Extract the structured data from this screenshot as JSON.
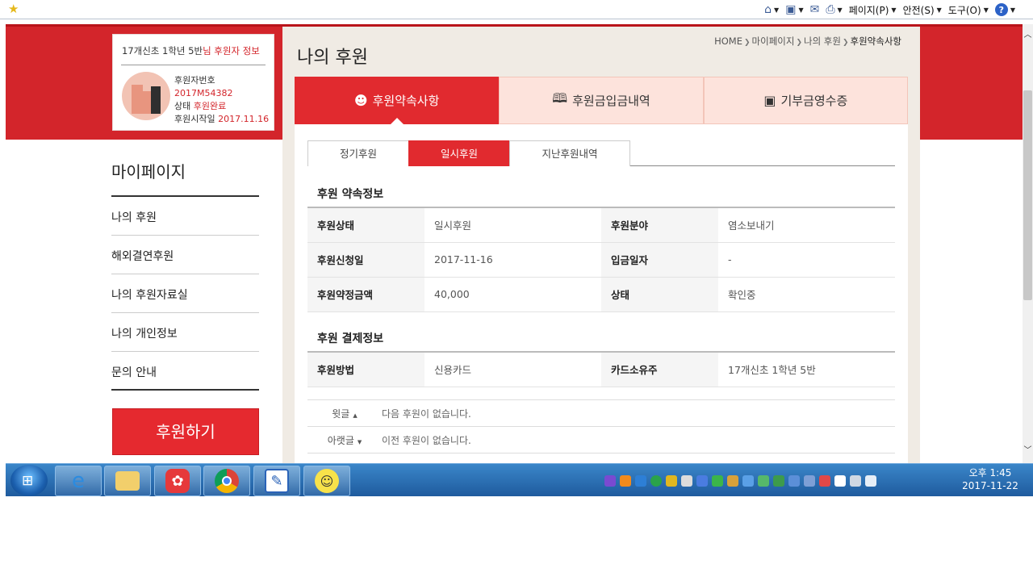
{
  "ie_toolbar": {
    "page_menu": "페이지(P)",
    "safety_menu": "안전(S)",
    "tools_menu": "도구(O)",
    "help_label": "?"
  },
  "donor": {
    "title_prefix": "17개신초 1학년 5반",
    "title_suffix": "님 후원자 정보",
    "rows": [
      {
        "label": "후원자번호",
        "value": ""
      },
      {
        "label": "",
        "value": "2017M54382"
      },
      {
        "label": "상태 ",
        "value": "후원완료"
      },
      {
        "label": "후원시작일 ",
        "value": "2017.11.16"
      }
    ]
  },
  "sidebar": {
    "title": "마이페이지",
    "items": [
      {
        "label": "나의 후원"
      },
      {
        "label": "해외결연후원"
      },
      {
        "label": "나의 후원자료실"
      },
      {
        "label": "나의 개인정보"
      },
      {
        "label": "문의 안내"
      }
    ],
    "donate_button": "후원하기"
  },
  "page": {
    "title": "나의 후원",
    "breadcrumb": [
      "HOME",
      "마이페이지",
      "나의 후원",
      "후원약속사항"
    ]
  },
  "big_tabs": [
    {
      "label": "후원약속사항",
      "icon": "smiley-icon",
      "glyph": "☻"
    },
    {
      "label": "후원금입금내역",
      "icon": "book-icon",
      "glyph": "🕮"
    },
    {
      "label": "기부금영수증",
      "icon": "receipt-icon",
      "glyph": "▣"
    }
  ],
  "sub_tabs": [
    {
      "label": "정기후원"
    },
    {
      "label": "일시후원"
    },
    {
      "label": "지난후원내역"
    }
  ],
  "promise_section": {
    "title": "후원 약속정보",
    "rows": [
      {
        "l1": "후원상태",
        "v1": "일시후원",
        "l2": "후원분야",
        "v2": "염소보내기"
      },
      {
        "l1": "후원신청일",
        "v1": "2017-11-16",
        "l2": "입금일자",
        "v2": "-"
      },
      {
        "l1": "후원약정금액",
        "v1": "40,000",
        "l2": "상태",
        "v2": "확인중"
      }
    ]
  },
  "payment_section": {
    "title": "후원 결제정보",
    "rows": [
      {
        "l1": "후원방법",
        "v1": "신용카드",
        "l2": "카드소유주",
        "v2": "17개신초 1학년 5반"
      }
    ]
  },
  "post_nav": [
    {
      "label": "윗글",
      "arrow": "▲",
      "text": "다음 후원이 없습니다."
    },
    {
      "label": "아랫글",
      "arrow": "▼",
      "text": "이전 후원이 없습니다."
    }
  ],
  "taskbar": {
    "time": "오후 1:45",
    "date": "2017-11-22"
  },
  "colors": {
    "brand_red": "#e12a2f",
    "band_red": "#d3252b",
    "tab_pink": "#fde3dc",
    "panel_beige": "#f0ebe4"
  }
}
